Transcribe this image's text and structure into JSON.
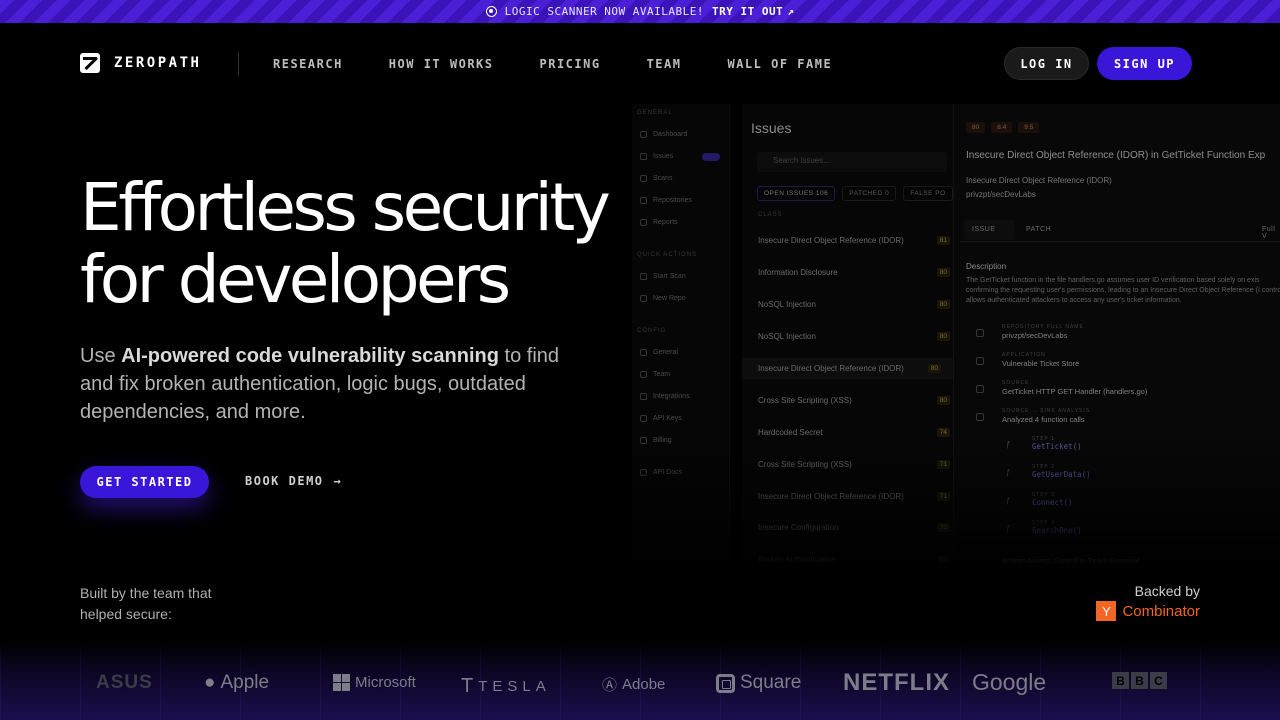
{
  "announcement": {
    "message": "LOGIC SCANNER NOW AVAILABLE!",
    "cta": "TRY IT OUT",
    "arrow": "↗"
  },
  "nav": {
    "brand": "ZEROPATH",
    "links": [
      "RESEARCH",
      "HOW IT WORKS",
      "PRICING",
      "TEAM",
      "WALL OF FAME"
    ],
    "login": "LOG IN",
    "signup": "SIGN UP"
  },
  "hero": {
    "title_line1": "Effortless security",
    "title_line2": "for developers",
    "sub_prefix": "Use ",
    "sub_bold": "AI-powered code vulnerability scanning",
    "sub_suffix": " to find and fix broken authentication, logic bugs, outdated dependencies, and more.",
    "cta_primary": "GET STARTED",
    "cta_secondary": "BOOK DEMO",
    "cta_arrow": "→"
  },
  "app_preview": {
    "sidebar": {
      "general_heading": "GENERAL",
      "general_items": [
        "Dashboard",
        "Issues",
        "Scans",
        "Repositories",
        "Reports"
      ],
      "quick_heading": "QUICK ACTIONS",
      "quick_items": [
        "Start Scan",
        "New Repo"
      ],
      "config_heading": "CONFIG",
      "config_items": [
        "General",
        "Team",
        "Integrations",
        "API Keys",
        "Billing"
      ],
      "footer_item": "API Docs"
    },
    "issues": {
      "title": "Issues",
      "search_placeholder": "Search issues...",
      "chips": [
        "OPEN ISSUES  106",
        "PATCHED  0",
        "FALSE PO"
      ],
      "column_header": "CLASS",
      "rows": [
        {
          "name": "Insecure Direct Object Reference (IDOR)",
          "score": "81"
        },
        {
          "name": "Information Disclosure",
          "score": "80"
        },
        {
          "name": "NoSQL Injection",
          "score": "80"
        },
        {
          "name": "NoSQL Injection",
          "score": "80"
        },
        {
          "name": "Insecure Direct Object Reference (IDOR)",
          "score": "80"
        },
        {
          "name": "Cross Site Scripting (XSS)",
          "score": "80"
        },
        {
          "name": "Hardcoded Secret",
          "score": "74"
        },
        {
          "name": "Cross Site Scripting (XSS)",
          "score": "71"
        },
        {
          "name": "Insecure Direct Object Reference (IDOR)",
          "score": "71"
        },
        {
          "name": "Insecure Configuration",
          "score": "70"
        },
        {
          "name": "Broken Authentication",
          "score": "69"
        }
      ]
    },
    "detail": {
      "scores": [
        "80",
        "8.4",
        "9.5"
      ],
      "title": "Insecure Direct Object Reference (IDOR) in GetTicket Function Exp",
      "vuln_class": "Insecure Direct Object Reference (IDOR)",
      "repo": "privzpt/secDevLabs",
      "tab_issue": "ISSUE",
      "tab_patch": "PATCH",
      "tab_full": "Full V",
      "description_heading": "Description",
      "description": "The GetTicket function in the file handlers.go assumes user ID verification based solely on exis confirming the requesting user's permissions, leading to an Insecure Direct Object Reference (I control allows authenticated attackers to access any user's ticket information.",
      "fields": [
        {
          "label": "REPOSITORY FULL NAME",
          "value": "privzpt/secDevLabs"
        },
        {
          "label": "APPLICATION",
          "value": "Vulnerable Ticket Store"
        },
        {
          "label": "SOURCE",
          "value": "GetTicket HTTP GET Handler  (handlers.go)"
        },
        {
          "label": "SOURCE → SINK ANALYSIS",
          "value": "Analyzed  4  function calls"
        }
      ],
      "steps": [
        {
          "label": "STEP 1",
          "value": "GetTicket()"
        },
        {
          "label": "STEP 2",
          "value": "GetUserData()"
        },
        {
          "label": "STEP 3",
          "value": "Connect()"
        },
        {
          "label": "STEP 4",
          "value": "SearchOne()"
        }
      ],
      "sink": "Broken Access Control in Ticket Retrieval"
    }
  },
  "social_proof": {
    "built_by": "Built by the team that helped secure:",
    "backed_by": "Backed by",
    "yc_letter": "Y",
    "yc_name": "Combinator",
    "logos": [
      "ASUS",
      "Apple",
      "Microsoft",
      "TESLA",
      "Adobe",
      "Square",
      "NETFLIX",
      "Google",
      "BBC"
    ]
  },
  "colors": {
    "accent": "#3a16d8",
    "background": "#000000",
    "yc_orange": "#f26522"
  }
}
